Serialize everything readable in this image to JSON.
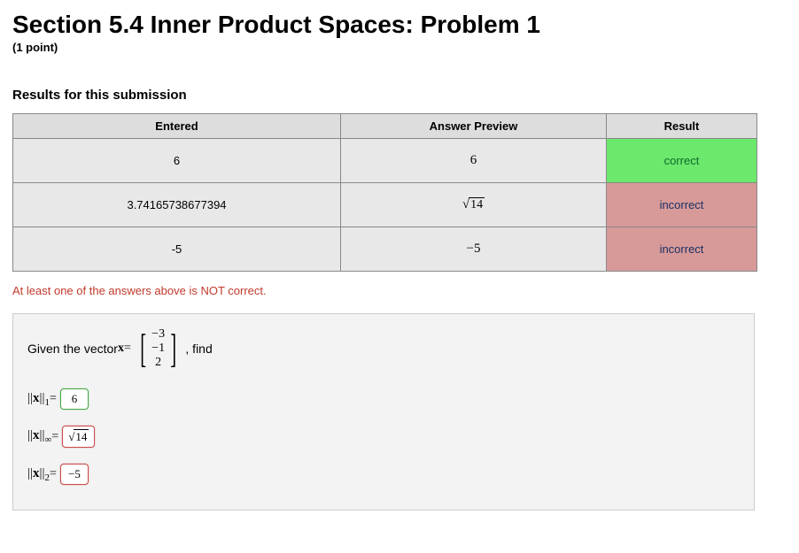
{
  "title": "Section 5.4 Inner Product Spaces: Problem 1",
  "points": "(1 point)",
  "results_heading": "Results for this submission",
  "headers": {
    "entered": "Entered",
    "preview": "Answer Preview",
    "result": "Result"
  },
  "rows": [
    {
      "entered": "6",
      "preview_plain": "6",
      "preview_sqrt": "",
      "result": "correct",
      "status": "ok"
    },
    {
      "entered": "3.74165738677394",
      "preview_plain": "",
      "preview_sqrt": "14",
      "result": "incorrect",
      "status": "bad"
    },
    {
      "entered": "-5",
      "preview_plain": "−5",
      "preview_sqrt": "",
      "result": "incorrect",
      "status": "bad"
    }
  ],
  "warning": "At least one of the answers above is NOT correct.",
  "problem": {
    "given_label": "Given the vector ",
    "x_symbol": "x",
    "equals": " = ",
    "vector": [
      "−3",
      "−1",
      "2"
    ],
    "find_label": " ,  find",
    "norms": {
      "n1": {
        "label_prefix": "||",
        "label_x": "x",
        "label_suffix": "||",
        "sub": "1",
        "eq": " = ",
        "value": "6",
        "status": "ok"
      },
      "ninf": {
        "label_prefix": "||",
        "label_x": "x",
        "label_suffix": "||",
        "sub": "∞",
        "eq": " = ",
        "sqrt_value": "14",
        "status": "bad"
      },
      "n2": {
        "label_prefix": "||",
        "label_x": "x",
        "label_suffix": "||",
        "sub": "2",
        "eq": " = ",
        "value": "−5",
        "status": "bad"
      }
    }
  }
}
